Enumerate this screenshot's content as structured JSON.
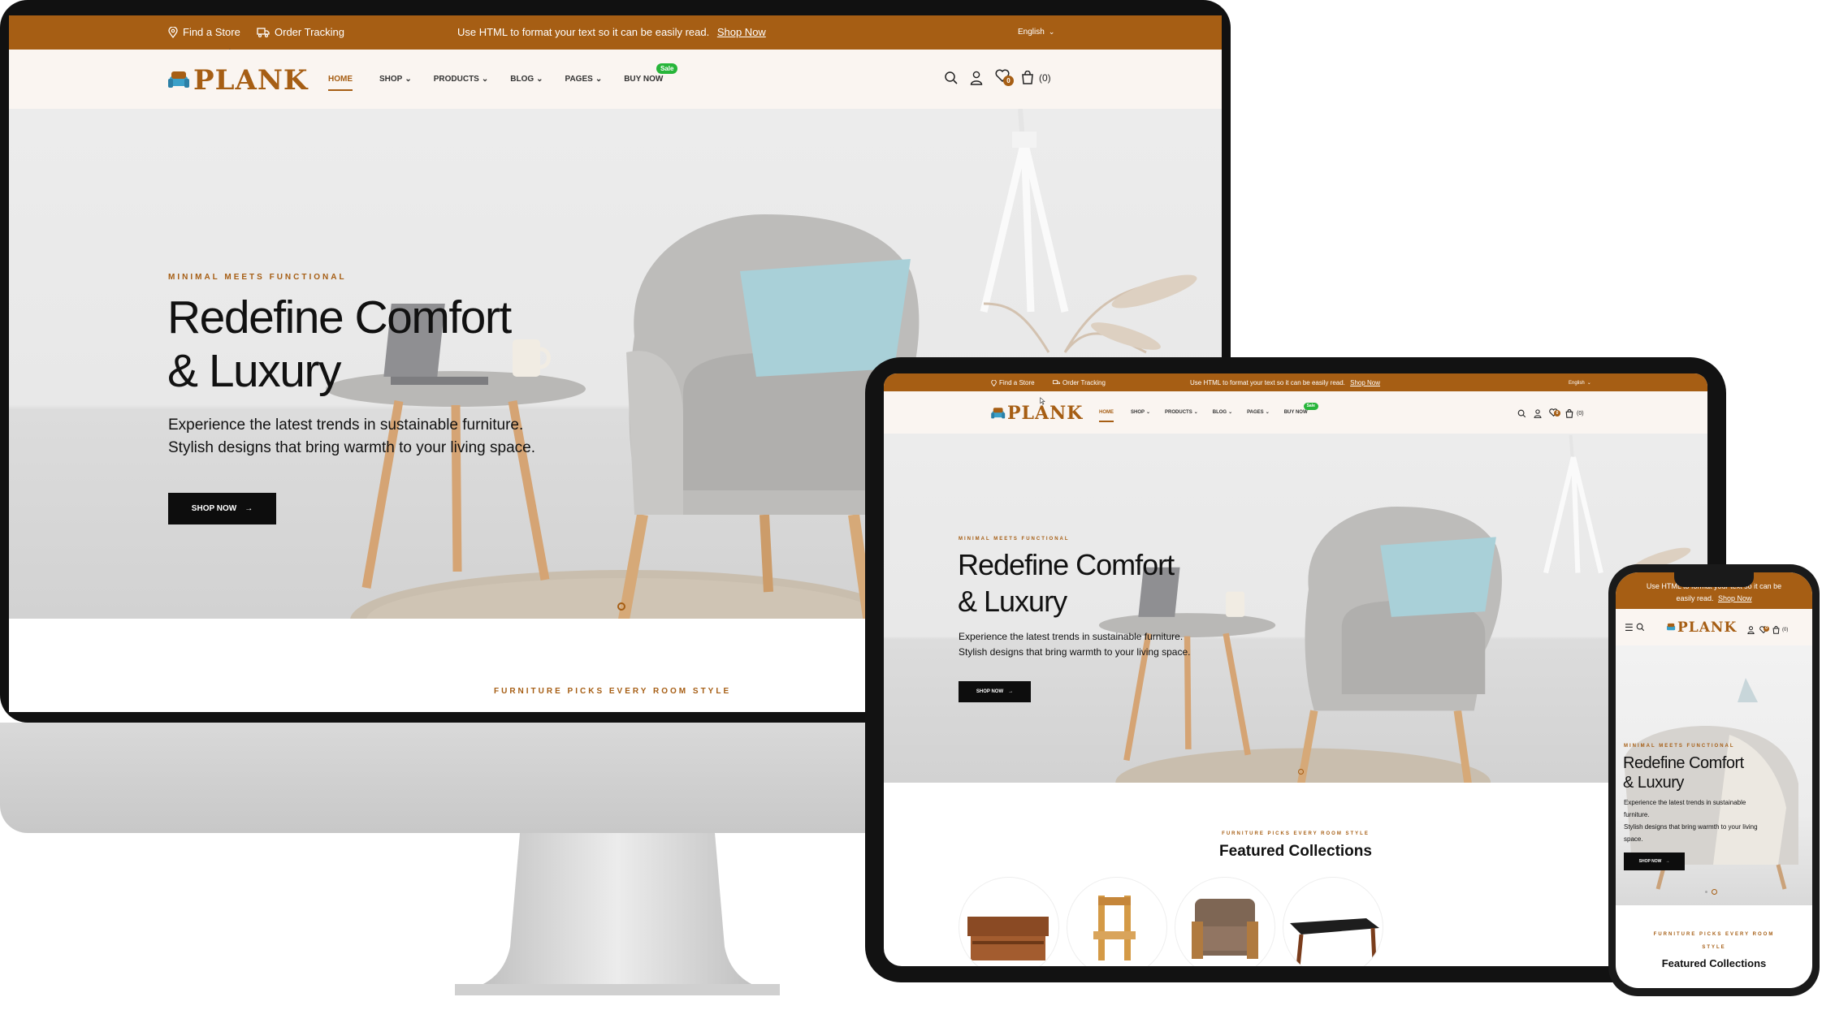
{
  "site": {
    "brand": "PLANK",
    "topbar": {
      "find_store": "Find a Store",
      "order_tracking": "Order Tracking",
      "promo_text": "Use HTML to format your text so it can be easily read.",
      "promo_link": "Shop Now",
      "language": "English"
    },
    "nav": {
      "home": "HOME",
      "shop": "SHOP",
      "products": "PRODUCTS",
      "blog": "BLOG",
      "pages": "PAGES",
      "buy_now": "BUY NOW",
      "sale_badge": "Sale"
    },
    "header_icons": {
      "wishlist_count": "0",
      "cart_count": "(0)"
    },
    "hero": {
      "kicker": "MINIMAL MEETS FUNCTIONAL",
      "title_line1": "Redefine Comfort",
      "title_line2": "& Luxury",
      "desc_line1": "Experience the latest trends in sustainable furniture.",
      "desc_line2": "Stylish designs that bring warmth to your living space.",
      "cta": "SHOP NOW"
    },
    "featured": {
      "kicker": "FURNITURE PICKS EVERY ROOM STYLE",
      "title": "Featured Collections"
    },
    "mobile": {
      "promo_line1": "Use HTML to format your text so it can be",
      "promo_line2": "easily read.",
      "desc_line1": "Experience the latest trends in sustainable",
      "desc_line2": "furniture.",
      "desc_line3": "Stylish designs that bring warmth to your living",
      "desc_line4": "space.",
      "kicker_line1": "FURNITURE PICKS EVERY ROOM",
      "kicker_line2": "STYLE"
    }
  },
  "colors": {
    "brand_brown": "#a65e14",
    "header_bg": "#faf5f1",
    "sale_green": "#27b53a",
    "button_black": "#0d0d0d"
  }
}
